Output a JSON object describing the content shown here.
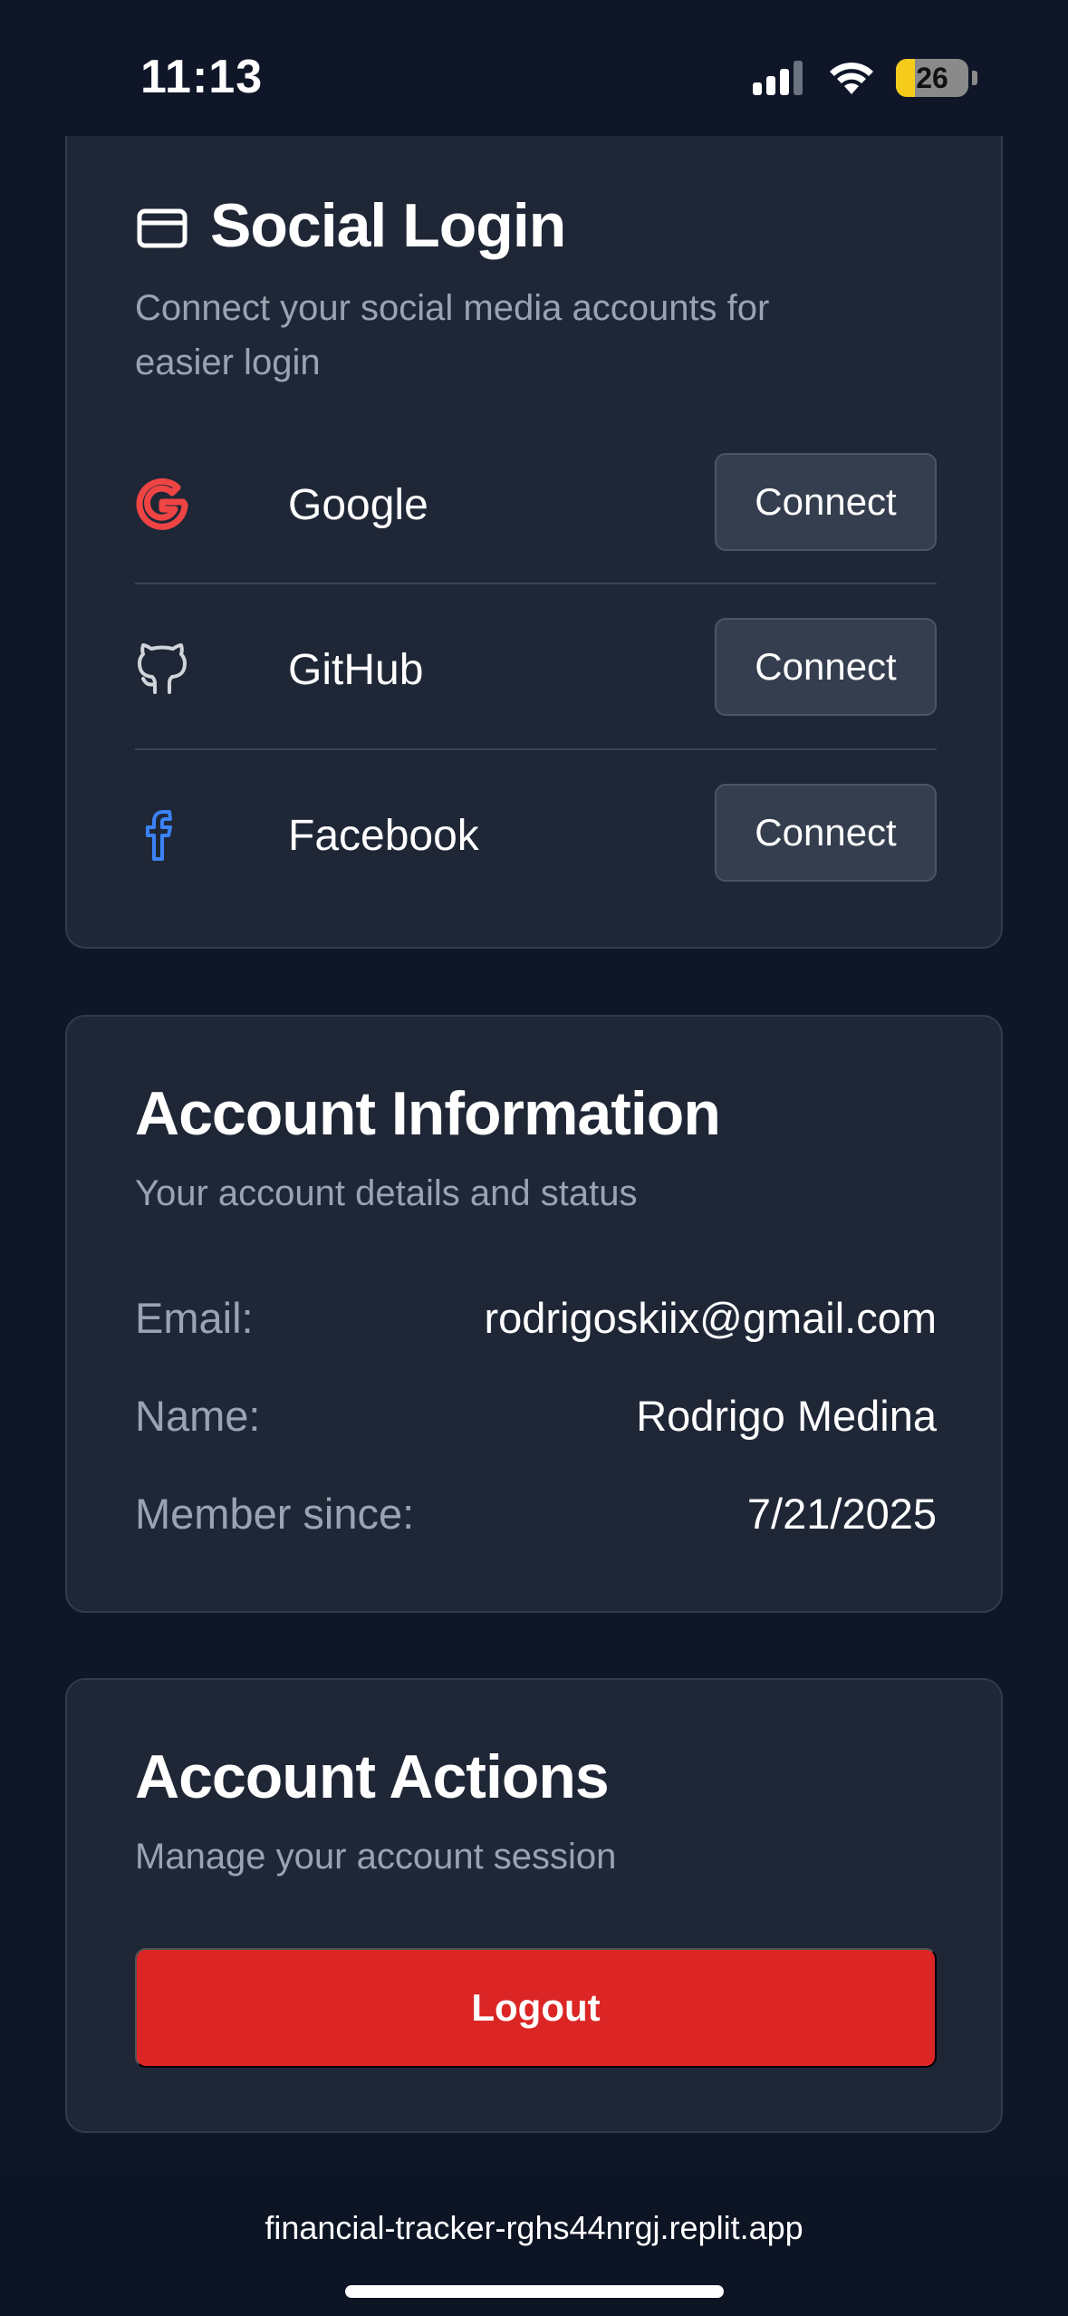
{
  "status_bar": {
    "time": "11:13",
    "battery_percent": "26",
    "battery_level": 0.26,
    "signal_icon": "cellular-signal-icon",
    "wifi_icon": "wifi-icon"
  },
  "social_login": {
    "icon": "credit-card-icon",
    "title": "Social Login",
    "subtitle": "Connect your social media accounts for easier login",
    "providers": [
      {
        "name": "Google",
        "icon": "google-icon",
        "action": "Connect",
        "color": "#ef4444"
      },
      {
        "name": "GitHub",
        "icon": "github-icon",
        "action": "Connect",
        "color": "#d1d5db"
      },
      {
        "name": "Facebook",
        "icon": "facebook-icon",
        "action": "Connect",
        "color": "#3b82f6"
      }
    ]
  },
  "account_info": {
    "title": "Account Information",
    "subtitle": "Your account details and status",
    "rows": [
      {
        "label": "Email:",
        "value": "rodrigoskiix@gmail.com"
      },
      {
        "label": "Name:",
        "value": "Rodrigo Medina"
      },
      {
        "label": "Member since:",
        "value": "7/21/2025"
      }
    ]
  },
  "account_actions": {
    "title": "Account Actions",
    "subtitle": "Manage your account session",
    "logout_label": "Logout",
    "logout_color": "#dc2626"
  },
  "browser": {
    "url": "financial-tracker-rghs44nrgj.replit.app"
  }
}
